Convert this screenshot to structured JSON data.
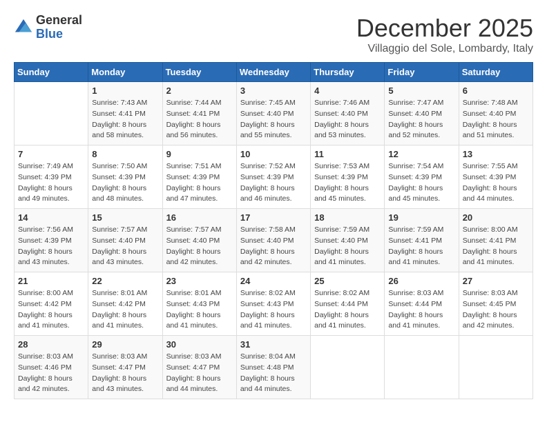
{
  "header": {
    "logo_general": "General",
    "logo_blue": "Blue",
    "month": "December 2025",
    "location": "Villaggio del Sole, Lombardy, Italy"
  },
  "weekdays": [
    "Sunday",
    "Monday",
    "Tuesday",
    "Wednesday",
    "Thursday",
    "Friday",
    "Saturday"
  ],
  "weeks": [
    [
      {
        "day": null
      },
      {
        "day": "1",
        "sunrise": "7:43 AM",
        "sunset": "4:41 PM",
        "daylight": "8 hours and 58 minutes."
      },
      {
        "day": "2",
        "sunrise": "7:44 AM",
        "sunset": "4:41 PM",
        "daylight": "8 hours and 56 minutes."
      },
      {
        "day": "3",
        "sunrise": "7:45 AM",
        "sunset": "4:40 PM",
        "daylight": "8 hours and 55 minutes."
      },
      {
        "day": "4",
        "sunrise": "7:46 AM",
        "sunset": "4:40 PM",
        "daylight": "8 hours and 53 minutes."
      },
      {
        "day": "5",
        "sunrise": "7:47 AM",
        "sunset": "4:40 PM",
        "daylight": "8 hours and 52 minutes."
      },
      {
        "day": "6",
        "sunrise": "7:48 AM",
        "sunset": "4:40 PM",
        "daylight": "8 hours and 51 minutes."
      }
    ],
    [
      {
        "day": "7",
        "sunrise": "7:49 AM",
        "sunset": "4:39 PM",
        "daylight": "8 hours and 49 minutes."
      },
      {
        "day": "8",
        "sunrise": "7:50 AM",
        "sunset": "4:39 PM",
        "daylight": "8 hours and 48 minutes."
      },
      {
        "day": "9",
        "sunrise": "7:51 AM",
        "sunset": "4:39 PM",
        "daylight": "8 hours and 47 minutes."
      },
      {
        "day": "10",
        "sunrise": "7:52 AM",
        "sunset": "4:39 PM",
        "daylight": "8 hours and 46 minutes."
      },
      {
        "day": "11",
        "sunrise": "7:53 AM",
        "sunset": "4:39 PM",
        "daylight": "8 hours and 45 minutes."
      },
      {
        "day": "12",
        "sunrise": "7:54 AM",
        "sunset": "4:39 PM",
        "daylight": "8 hours and 45 minutes."
      },
      {
        "day": "13",
        "sunrise": "7:55 AM",
        "sunset": "4:39 PM",
        "daylight": "8 hours and 44 minutes."
      }
    ],
    [
      {
        "day": "14",
        "sunrise": "7:56 AM",
        "sunset": "4:39 PM",
        "daylight": "8 hours and 43 minutes."
      },
      {
        "day": "15",
        "sunrise": "7:57 AM",
        "sunset": "4:40 PM",
        "daylight": "8 hours and 43 minutes."
      },
      {
        "day": "16",
        "sunrise": "7:57 AM",
        "sunset": "4:40 PM",
        "daylight": "8 hours and 42 minutes."
      },
      {
        "day": "17",
        "sunrise": "7:58 AM",
        "sunset": "4:40 PM",
        "daylight": "8 hours and 42 minutes."
      },
      {
        "day": "18",
        "sunrise": "7:59 AM",
        "sunset": "4:40 PM",
        "daylight": "8 hours and 41 minutes."
      },
      {
        "day": "19",
        "sunrise": "7:59 AM",
        "sunset": "4:41 PM",
        "daylight": "8 hours and 41 minutes."
      },
      {
        "day": "20",
        "sunrise": "8:00 AM",
        "sunset": "4:41 PM",
        "daylight": "8 hours and 41 minutes."
      }
    ],
    [
      {
        "day": "21",
        "sunrise": "8:00 AM",
        "sunset": "4:42 PM",
        "daylight": "8 hours and 41 minutes."
      },
      {
        "day": "22",
        "sunrise": "8:01 AM",
        "sunset": "4:42 PM",
        "daylight": "8 hours and 41 minutes."
      },
      {
        "day": "23",
        "sunrise": "8:01 AM",
        "sunset": "4:43 PM",
        "daylight": "8 hours and 41 minutes."
      },
      {
        "day": "24",
        "sunrise": "8:02 AM",
        "sunset": "4:43 PM",
        "daylight": "8 hours and 41 minutes."
      },
      {
        "day": "25",
        "sunrise": "8:02 AM",
        "sunset": "4:44 PM",
        "daylight": "8 hours and 41 minutes."
      },
      {
        "day": "26",
        "sunrise": "8:03 AM",
        "sunset": "4:44 PM",
        "daylight": "8 hours and 41 minutes."
      },
      {
        "day": "27",
        "sunrise": "8:03 AM",
        "sunset": "4:45 PM",
        "daylight": "8 hours and 42 minutes."
      }
    ],
    [
      {
        "day": "28",
        "sunrise": "8:03 AM",
        "sunset": "4:46 PM",
        "daylight": "8 hours and 42 minutes."
      },
      {
        "day": "29",
        "sunrise": "8:03 AM",
        "sunset": "4:47 PM",
        "daylight": "8 hours and 43 minutes."
      },
      {
        "day": "30",
        "sunrise": "8:03 AM",
        "sunset": "4:47 PM",
        "daylight": "8 hours and 44 minutes."
      },
      {
        "day": "31",
        "sunrise": "8:04 AM",
        "sunset": "4:48 PM",
        "daylight": "8 hours and 44 minutes."
      },
      {
        "day": null
      },
      {
        "day": null
      },
      {
        "day": null
      }
    ]
  ]
}
